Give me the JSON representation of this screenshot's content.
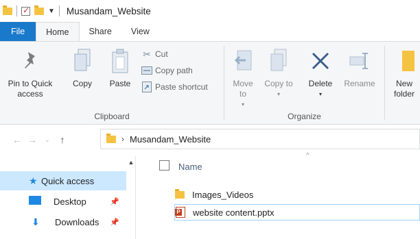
{
  "window": {
    "title": "Musandam_Website"
  },
  "tabs": [
    {
      "label": "File"
    },
    {
      "label": "Home"
    },
    {
      "label": "Share"
    },
    {
      "label": "View"
    }
  ],
  "ribbon": {
    "clipboard": {
      "label": "Clipboard",
      "pin_label": "Pin to Quick access",
      "copy_label": "Copy",
      "paste_label": "Paste",
      "cut_label": "Cut",
      "copy_path_label": "Copy path",
      "paste_shortcut_label": "Paste shortcut"
    },
    "organize": {
      "label": "Organize",
      "move_to_label": "Move to",
      "copy_to_label": "Copy to",
      "delete_label": "Delete",
      "rename_label": "Rename"
    },
    "new": {
      "new_folder_label": "New folder"
    }
  },
  "address": {
    "path": "Musandam_Website"
  },
  "nav": {
    "items": [
      {
        "label": "Quick access"
      },
      {
        "label": "Desktop"
      },
      {
        "label": "Downloads"
      }
    ]
  },
  "files": {
    "column_name": "Name",
    "rows": [
      {
        "name": "Images_Videos"
      },
      {
        "name": "website content.pptx"
      }
    ]
  },
  "colors": {
    "accent": "#1979ca",
    "selection": "#cce8ff",
    "folder": "#f5c342"
  }
}
